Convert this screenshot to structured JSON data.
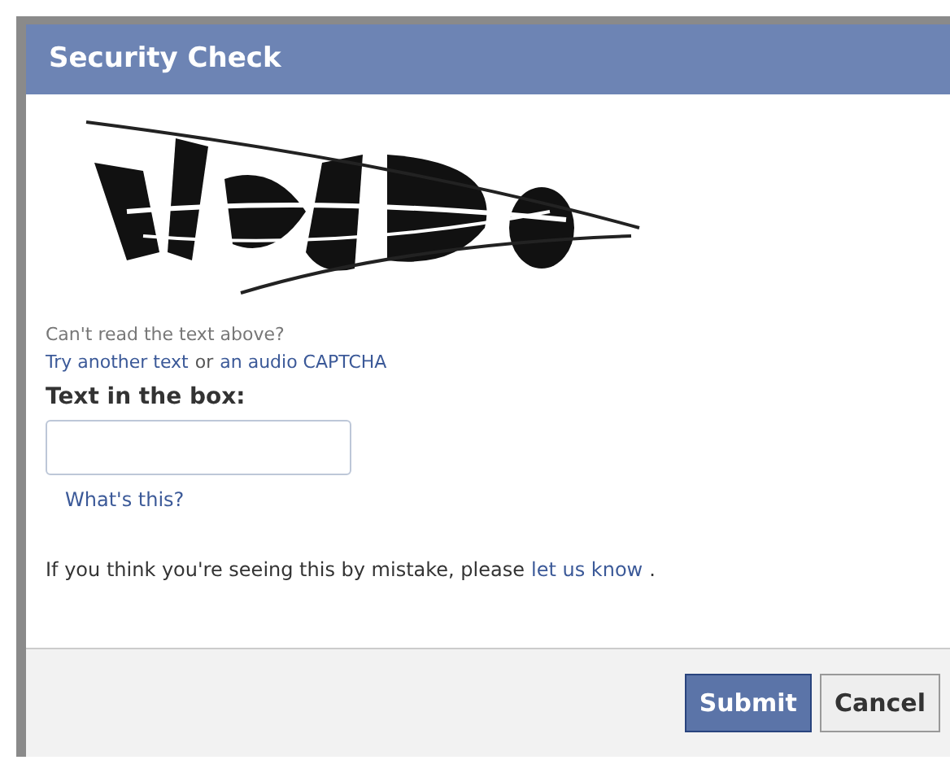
{
  "dialog": {
    "title": "Security Check",
    "help_prompt": "Can't read the text above?",
    "help_links": [
      {
        "kind": "link",
        "text": "Try another text"
      },
      {
        "kind": "text",
        "text": "or"
      },
      {
        "kind": "link",
        "text": "an audio CAPTCHA"
      }
    ],
    "field_label": "Text in the box:",
    "whats_this": "What's this?",
    "notice": [
      {
        "kind": "text",
        "text": "If you think you're seeing this by mistake, please"
      },
      {
        "kind": "link",
        "text": "let us know"
      },
      {
        "kind": "text",
        "text": "."
      }
    ],
    "buttons": [
      {
        "kind": "primary",
        "label": "Submit"
      },
      {
        "kind": "secondary",
        "label": "Cancel"
      }
    ]
  }
}
